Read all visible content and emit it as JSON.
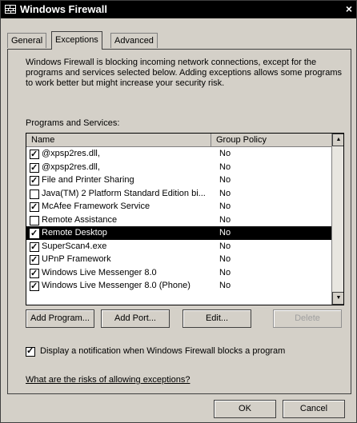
{
  "window": {
    "title": "Windows Firewall",
    "close_glyph": "×"
  },
  "tabs": [
    {
      "label": "General"
    },
    {
      "label": "Exceptions"
    },
    {
      "label": "Advanced"
    }
  ],
  "description": "Windows Firewall is blocking incoming network connections, except for the programs and services selected below. Adding exceptions allows some programs to work better but might increase your security risk.",
  "programs_label": "Programs and Services:",
  "list": {
    "headers": {
      "name": "Name",
      "group_policy": "Group Policy"
    },
    "rows": [
      {
        "name": "@xpsp2res.dll,",
        "group_policy": "No",
        "checked": true
      },
      {
        "name": "@xpsp2res.dll,",
        "group_policy": "No",
        "checked": true
      },
      {
        "name": "File and Printer Sharing",
        "group_policy": "No",
        "checked": true
      },
      {
        "name": "Java(TM) 2 Platform Standard Edition bi...",
        "group_policy": "No",
        "checked": false
      },
      {
        "name": "McAfee Framework Service",
        "group_policy": "No",
        "checked": true
      },
      {
        "name": "Remote Assistance",
        "group_policy": "No",
        "checked": false
      },
      {
        "name": "Remote Desktop",
        "group_policy": "No",
        "checked": true,
        "selected": true
      },
      {
        "name": "SuperScan4.exe",
        "group_policy": "No",
        "checked": true
      },
      {
        "name": "UPnP Framework",
        "group_policy": "No",
        "checked": true
      },
      {
        "name": "Windows Live Messenger 8.0",
        "group_policy": "No",
        "checked": true
      },
      {
        "name": "Windows Live Messenger 8.0 (Phone)",
        "group_policy": "No",
        "checked": true
      }
    ]
  },
  "buttons": {
    "add_program": "Add Program...",
    "add_port": "Add Port...",
    "edit": "Edit...",
    "delete": "Delete"
  },
  "notify_label": "Display a notification when Windows Firewall blocks a program",
  "notify_checked": true,
  "risks_link": "What are the risks of allowing exceptions?",
  "footer": {
    "ok": "OK",
    "cancel": "Cancel"
  },
  "icons": {
    "app": "firewall-icon",
    "scroll_up": "▲",
    "scroll_down": "▼"
  }
}
